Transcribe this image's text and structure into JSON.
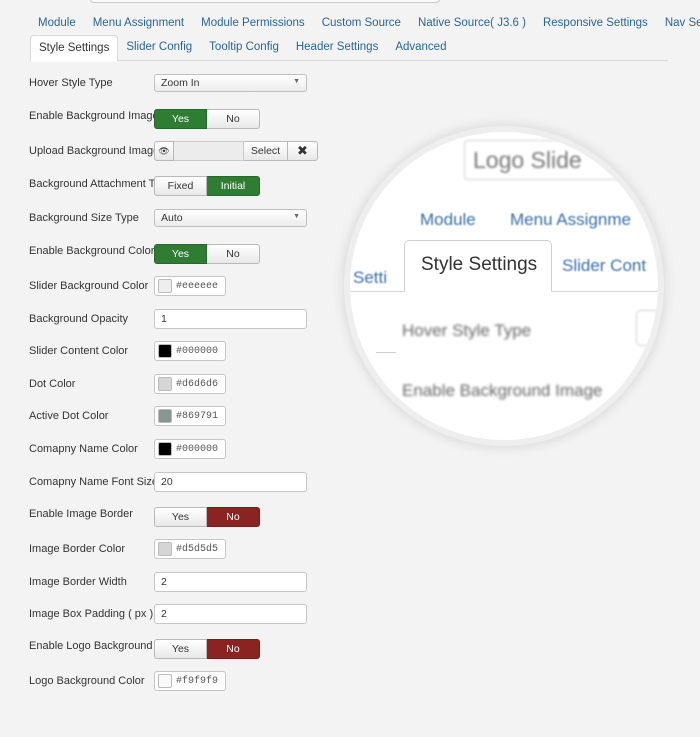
{
  "tabs_row1": [
    "Module",
    "Menu Assignment",
    "Module Permissions",
    "Custom Source",
    "Native Source( J3.6 )",
    "Responsive Settings",
    "Nav Settings"
  ],
  "tabs_row2": [
    "Style Settings",
    "Slider Config",
    "Tooltip Config",
    "Header Settings",
    "Advanced"
  ],
  "active_tab": "Style Settings",
  "form": {
    "hover_style_type": {
      "label": "Hover Style Type",
      "value": "Zoom In"
    },
    "enable_bg_image": {
      "label": "Enable Background Image",
      "yes": "Yes",
      "no": "No",
      "selected": "Yes"
    },
    "upload_bg_image": {
      "label": "Upload Background Image",
      "select": "Select"
    },
    "bg_attachment": {
      "label": "Background Attachment Type",
      "fixed": "Fixed",
      "initial": "Initial",
      "selected": "Initial"
    },
    "bg_size_type": {
      "label": "Background Size Type",
      "value": "Auto"
    },
    "enable_bg_color": {
      "label": "Enable Background Color",
      "yes": "Yes",
      "no": "No",
      "selected": "Yes"
    },
    "slider_bg_color": {
      "label": "Slider Background Color",
      "value": "#eeeeee"
    },
    "bg_opacity": {
      "label": "Background Opacity",
      "value": "1"
    },
    "slider_content_color": {
      "label": "Slider Content Color",
      "value": "#000000"
    },
    "dot_color": {
      "label": "Dot Color",
      "value": "#d6d6d6"
    },
    "active_dot_color": {
      "label": "Active Dot Color",
      "value": "#869791"
    },
    "company_name_color": {
      "label": "Comapny Name Color",
      "value": "#000000"
    },
    "company_name_font_size": {
      "label": "Comapny Name Font Size",
      "value": "20"
    },
    "enable_image_border": {
      "label": "Enable Image Border",
      "yes": "Yes",
      "no": "No",
      "selected": "No"
    },
    "image_border_color": {
      "label": "Image Border Color",
      "value": "#d5d5d5"
    },
    "image_border_width": {
      "label": "Image Border Width",
      "value": "2"
    },
    "image_box_padding": {
      "label": "Image Box Padding ( px )",
      "value": "2"
    },
    "enable_logo_bg": {
      "label": "Enable Logo Background",
      "yes": "Yes",
      "no": "No",
      "selected": "No"
    },
    "logo_bg_color": {
      "label": "Logo Background Color",
      "value": "#f9f9f9"
    }
  },
  "magnifier": {
    "logo_text": "Logo Slide",
    "tab_module": "Module",
    "tab_menu": "Menu Assignme",
    "tab_style": "Style Settings",
    "tab_slider": "Slider Cont",
    "tab_left": "Setti",
    "label_hover": "Hover Style Type",
    "label_enable_bg": "Enable Background Image"
  },
  "colors": {
    "green": "#2f7d32",
    "red": "#8b2323",
    "link": "#2a6496"
  },
  "icons": {
    "eye": "eye-icon",
    "clear": "close-icon",
    "caret": "chevron-down-icon"
  }
}
